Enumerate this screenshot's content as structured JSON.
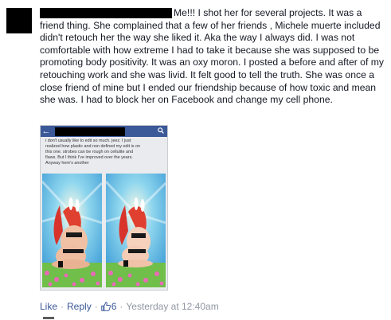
{
  "comment": {
    "text": "Me!!! I shot her for several projects. It was a friend thing. She complained that a few of her friends , Michele muerte included didn't retouch her the way she liked it. Aka the way I always did. I was not comfortable with how extreme I had to take it because she was supposed to be promoting body positivity. It was an oxy moron. I posted a before and after of my retouching work and she was livid. It felt good to tell the truth. She was once a close friend of mine but I ended our friendship because of how toxic and mean she was. I had to block her on Facebook and change my cell phone."
  },
  "attachment": {
    "post_text": "i don't usually like to edit so much. jeez. I just\nrealized how plastic and non defined my edit is on\nthis one. strobes can be rough on cellulite and\nflaws. But I think I've improved over the years.\nAnyway here's another",
    "icons": [
      "back-arrow-icon",
      "search-icon"
    ]
  },
  "actions": {
    "like": "Like",
    "reply": "Reply",
    "like_count": "6",
    "timestamp": "Yesterday at 12:40am",
    "separator": "·",
    "icons": [
      "thumbs-up-icon"
    ]
  },
  "colors": {
    "link": "#3b5998",
    "meta": "#9197a3",
    "text": "#141823",
    "facebook_bar": "#3b5998"
  }
}
